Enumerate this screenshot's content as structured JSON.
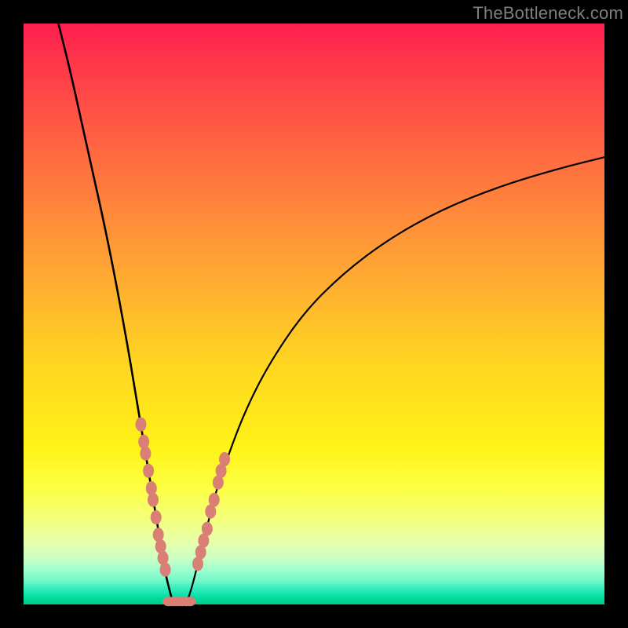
{
  "watermark": "TheBottleneck.com",
  "chart_data": {
    "type": "line",
    "title": "",
    "xlabel": "",
    "ylabel": "",
    "xlim": [
      0,
      100
    ],
    "ylim": [
      0,
      100
    ],
    "grid": false,
    "legend": false,
    "series": [
      {
        "name": "left-curve",
        "x": [
          6,
          8,
          10,
          12,
          14,
          16,
          18,
          19,
          20,
          21,
          22,
          23,
          23.5,
          24,
          24.5,
          25,
          25.5,
          26
        ],
        "y": [
          100,
          92,
          83,
          74,
          65,
          55,
          44,
          38,
          32,
          26,
          20,
          14,
          11,
          8,
          5,
          3,
          1,
          0
        ]
      },
      {
        "name": "right-curve",
        "x": [
          28,
          29,
          30,
          31,
          32,
          33,
          35,
          38,
          42,
          48,
          55,
          63,
          72,
          82,
          92,
          100
        ],
        "y": [
          0,
          3,
          7,
          11,
          15,
          19,
          25,
          33,
          41,
          50,
          57,
          63,
          68,
          72,
          75,
          77
        ]
      },
      {
        "name": "valley-floor",
        "x": [
          25,
          26,
          27,
          28,
          29
        ],
        "y": [
          0,
          0,
          0,
          0,
          0
        ]
      }
    ],
    "markers": {
      "left_cluster": {
        "x": [
          20.2,
          20.7,
          21.0,
          21.5,
          22.0,
          22.3,
          22.8,
          23.2,
          23.6,
          24.0,
          24.4
        ],
        "y": [
          31,
          28,
          26,
          23,
          20,
          18,
          15,
          12,
          10,
          8,
          6
        ]
      },
      "right_cluster": {
        "x": [
          30.0,
          30.5,
          31.0,
          31.6,
          32.2,
          32.8,
          33.5,
          34.0,
          34.6
        ],
        "y": [
          7,
          9,
          11,
          13,
          16,
          18,
          21,
          23,
          25
        ]
      },
      "bottom_cluster": {
        "x": [
          25.0,
          25.6,
          26.2,
          26.8,
          27.4,
          28.0,
          28.6
        ],
        "y": [
          0.5,
          0.5,
          0.5,
          0.5,
          0.5,
          0.5,
          0.5
        ]
      }
    },
    "marker_color": "#d97f76",
    "curve_color": "#000000"
  }
}
